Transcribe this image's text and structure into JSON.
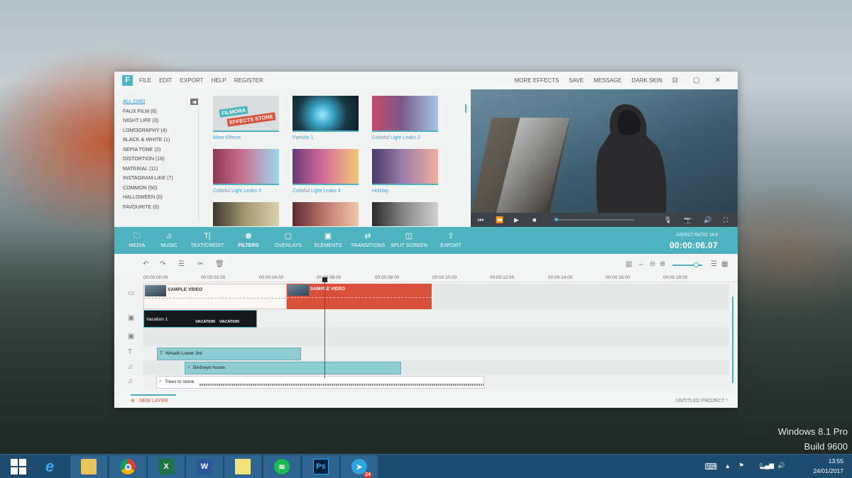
{
  "desktop": {
    "watermark_line1": "Windows 8.1 Pro",
    "watermark_line2": "Build 9600"
  },
  "app": {
    "logo": "F",
    "menu": [
      "FILE",
      "EDIT",
      "EXPORT",
      "HELP",
      "REGISTER"
    ],
    "right_menu": [
      "MORE EFFECTS",
      "SAVE",
      "MESSAGE",
      "DARK SKIN"
    ],
    "window_controls": [
      "⊟",
      "▢",
      "✕"
    ]
  },
  "categories": [
    "ALL (100)",
    "FAUX FILM (6)",
    "NIGHT LIFE (3)",
    "LOMOGRAPHY (4)",
    "BLACK & WHITE (1)",
    "SEPIA TONE (2)",
    "DISTORTION (16)",
    "MATERIAL (11)",
    "INSTAGRAM-LIKE (7)",
    "COMMON (50)",
    "HALLOWEEN (0)",
    "FAVOURITE (0)"
  ],
  "effects": [
    {
      "label": "More Effects",
      "store_line1": "FILMORA",
      "store_line2": "EFFECTS STORE"
    },
    {
      "label": "Particle 1"
    },
    {
      "label": "Colorful Light Leaks 2"
    },
    {
      "label": "Colorful Light Leaks 3"
    },
    {
      "label": "Colorful Light Leaks 4"
    },
    {
      "label": "Holiday"
    }
  ],
  "toolbar": {
    "items": [
      "MEDIA",
      "MUSIC",
      "TEXT/CREDIT",
      "FILTERS",
      "OVERLAYS",
      "ELEMENTS",
      "TRANSITIONS",
      "SPLIT SCREEN",
      "EXPORT"
    ],
    "active": "FILTERS",
    "aspect_ratio": "ASPECT RATIO: 16:9",
    "timecode": "00:00:06.07"
  },
  "ruler": [
    "00:00:00:00",
    "00:00:02:00",
    "00:00:04:00",
    "00:00:06:00",
    "00:00:08:00",
    "00:00:10:00",
    "00:00:12:00",
    "00:00:14:00",
    "00:00:16:00",
    "00:00:18:00"
  ],
  "clips": {
    "video1": "SAMPLE VIDEO",
    "video2": "SAMPLE VIDEO",
    "overlay": "Vacation 1",
    "overlay_badge": "VACATION",
    "text": "Wreath Lower 3rd",
    "music1": "Birdseye house",
    "music2": "Trees to stone"
  },
  "footer": {
    "new_layer": "NEW LAYER",
    "project": "UNTITLED PROJECT *"
  },
  "taskbar": {
    "excel": "X",
    "word": "W",
    "ps": "Ps",
    "telegram_badge": "24",
    "time": "13:55",
    "date": "24/01/2017"
  },
  "colors": {
    "accent": "#4fb3bf",
    "clip_red": "#d9503a",
    "taskbar": "#1e4c6e"
  }
}
